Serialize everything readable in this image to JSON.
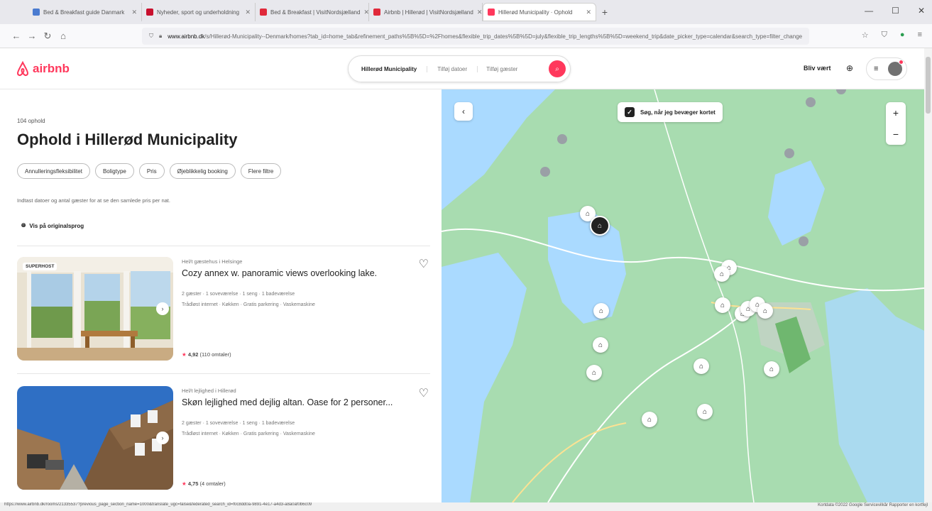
{
  "browser": {
    "tabs": [
      {
        "label": "Bed & Breakfast guide Danmark",
        "color": "#4a7bd0"
      },
      {
        "label": "Nyheder, sport og underholdning",
        "color": "#c8102e"
      },
      {
        "label": "Bed & Breakfast | VisitNordsjælland",
        "color": "#e0293a"
      },
      {
        "label": "Airbnb | Hillerød | VisitNordsjælland",
        "color": "#e0293a"
      },
      {
        "label": "Hillerød Municipality · Ophold",
        "color": "#ff385c"
      }
    ],
    "url_host": "www.airbnb.dk",
    "url_rest": "/s/Hillerød-Municipality--Denmark/homes?tab_id=home_tab&refinement_paths%5B%5D=%2Fhomes&flexible_trip_dates%5B%5D=july&flexible_trip_lengths%5B%5D=weekend_trip&date_picker_type=calendar&search_type=filter_change",
    "status_url": "https://www.airbnb.dk/rooms/21335537?previous_page_section_name=1000&translate_ugc=false&federated_search_id=f0c8dd0a-9891-4e17-a4d3-a8a0af0b6c09",
    "map_footer": "Kortdata ©2022 Google   Servicevilkår   Rapporter en kortfejl"
  },
  "header": {
    "logo_text": "airbnb",
    "search_location": "Hillerød Municipality",
    "search_dates": "Tilføj datoer",
    "search_guests": "Tilføj gæster",
    "host_link": "Bliv vært",
    "brand_color": "#ff385c"
  },
  "results": {
    "count": "104 ophold",
    "title": "Ophold i Hillerød Municipality",
    "filters": [
      "Annulleringsfleksibilitet",
      "Boligtype",
      "Pris",
      "Øjeblikkelig booking",
      "Flere filtre"
    ],
    "note": "Indtast datoer og antal gæster for at se den samlede pris per nat.",
    "translate": "Vis på originalsprog"
  },
  "listings": [
    {
      "badge": "SUPERHOST",
      "type": "Hel/t gæstehus i Helsinge",
      "name": "Cozy annex w. panoramic views overlooking lake.",
      "details": "2 gæster · 1 soveværelse · 1 seng · 1 badeværelse",
      "amenities": "Trådløst internet · Køkken · Gratis parkering · Vaskemaskine",
      "rating": "4,92",
      "reviews": "(110 omtaler)"
    },
    {
      "badge": "",
      "type": "Hel/t lejlighed i Hillerød",
      "name": "Skøn lejlighed med dejlig altan. Oase for 2 personer...",
      "details": "2 gæster · 1 soveværelse · 1 seng · 1 badeværelse",
      "amenities": "Trådløst internet · Køkken · Gratis parkering · Vaskemaskine",
      "rating": "4,75",
      "reviews": "(4 omtaler)"
    }
  ],
  "map": {
    "search_as_move": "Søg, når jeg bevæger kortet",
    "zoom_in": "+",
    "zoom_out": "−"
  }
}
